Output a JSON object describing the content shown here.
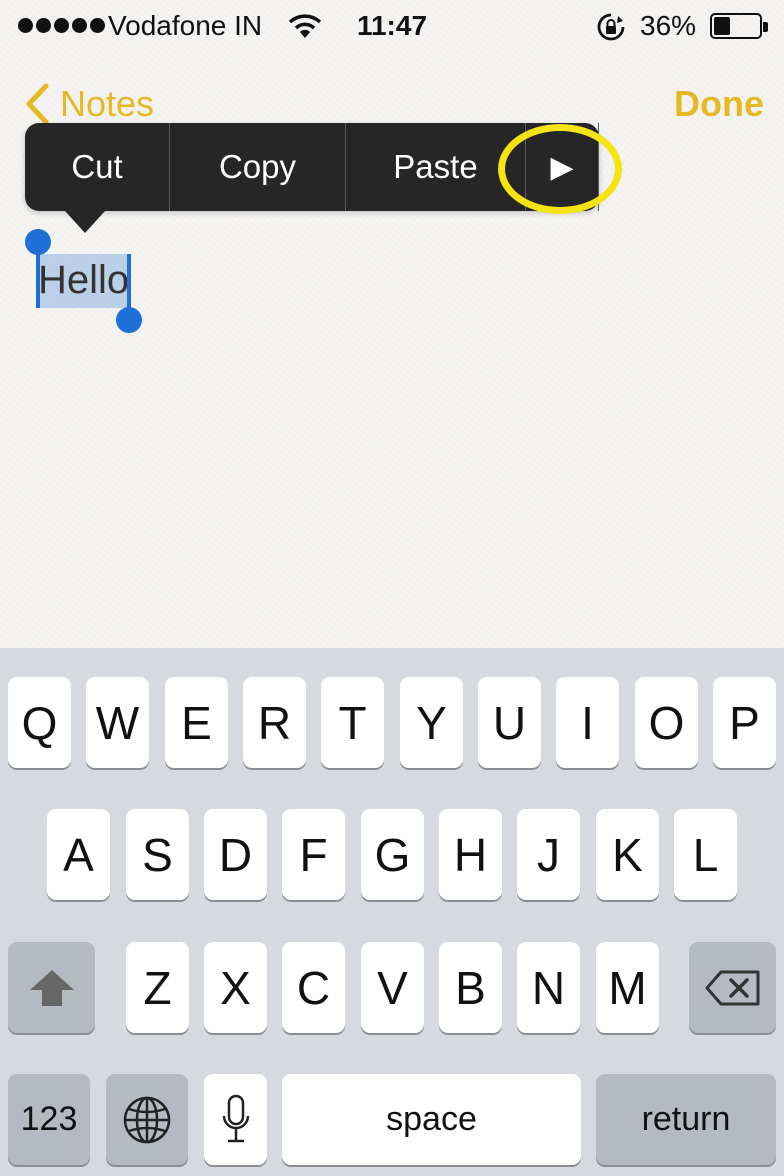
{
  "status_bar": {
    "carrier": "Vodafone IN",
    "time": "11:47",
    "battery_percent": "36%",
    "battery_level": 0.36,
    "icons": [
      "signal-dots-icon",
      "wifi-icon",
      "rotation-lock-icon",
      "battery-icon"
    ]
  },
  "nav": {
    "back_label": "Notes",
    "done_label": "Done",
    "accent_color": "#e5b824"
  },
  "edit_menu": {
    "cut": "Cut",
    "copy": "Copy",
    "paste": "Paste",
    "more": "▶"
  },
  "note": {
    "selected_text": "Hello"
  },
  "keyboard": {
    "row1": [
      "Q",
      "W",
      "E",
      "R",
      "T",
      "Y",
      "U",
      "I",
      "O",
      "P"
    ],
    "row2": [
      "A",
      "S",
      "D",
      "F",
      "G",
      "H",
      "J",
      "K",
      "L"
    ],
    "row3": [
      "Z",
      "X",
      "C",
      "V",
      "B",
      "N",
      "M"
    ],
    "numbers_label": "123",
    "space_label": "space",
    "return_label": "return"
  },
  "colors": {
    "selection_handle": "#1f6fd6",
    "highlight_ring": "#f5e313",
    "menu_background": "#262626"
  }
}
